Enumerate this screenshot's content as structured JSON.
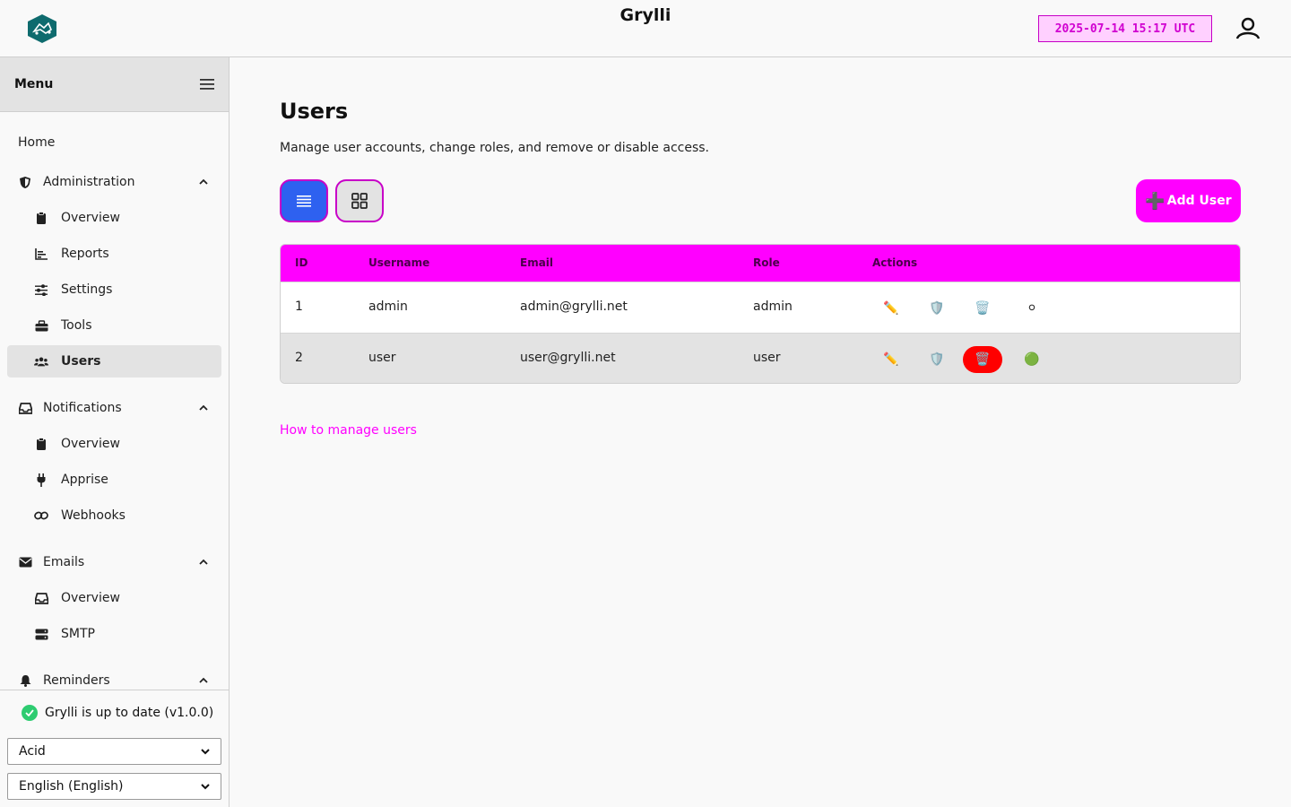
{
  "header": {
    "title": "Grylli",
    "datetime": "2025-07-14 15:17 UTC",
    "logo_icon": "grylli-logo-icon",
    "user_icon": "user-account-icon"
  },
  "sidebar": {
    "menu_title": "Menu",
    "home": "Home",
    "sections": [
      {
        "label": "Administration",
        "icon": "shield-icon",
        "items": [
          {
            "label": "Overview",
            "icon": "clipboard-icon"
          },
          {
            "label": "Reports",
            "icon": "chart-icon"
          },
          {
            "label": "Settings",
            "icon": "sliders-icon"
          },
          {
            "label": "Tools",
            "icon": "toolbox-icon"
          },
          {
            "label": "Users",
            "icon": "users-icon",
            "active": true
          }
        ]
      },
      {
        "label": "Notifications",
        "icon": "inbox-icon",
        "items": [
          {
            "label": "Overview",
            "icon": "clipboard-icon"
          },
          {
            "label": "Apprise",
            "icon": "plug-icon"
          },
          {
            "label": "Webhooks",
            "icon": "link-icon"
          }
        ]
      },
      {
        "label": "Emails",
        "icon": "envelope-icon",
        "items": [
          {
            "label": "Overview",
            "icon": "inbox-icon"
          },
          {
            "label": "SMTP",
            "icon": "server-icon"
          }
        ]
      },
      {
        "label": "Reminders",
        "icon": "bell-icon",
        "items": []
      }
    ],
    "footer": {
      "status": "Grylli is up to date (v1.0.0)",
      "theme": "Acid",
      "language": "English (English)"
    }
  },
  "main": {
    "title": "Users",
    "description": "Manage user accounts, change roles, and remove or disable access.",
    "add_button": "Add User",
    "add_button_icon": "➕",
    "table": {
      "columns": [
        "ID",
        "Username",
        "Email",
        "Role",
        "Actions"
      ],
      "rows": [
        {
          "id": "1",
          "username": "admin",
          "email": "admin@grylli.net",
          "role": "admin",
          "edit": "✏️",
          "role_action": "🛡️",
          "delete": "🗑️",
          "status_dot": "⚪"
        },
        {
          "id": "2",
          "username": "user",
          "email": "user@grylli.net",
          "role": "user",
          "edit": "✏️",
          "role_action": "🛡️",
          "delete": "🗑️",
          "status_dot": "🟢"
        }
      ]
    },
    "help_link": "How to manage users"
  },
  "colors": {
    "accent": "#ff00ff",
    "list_view": "#2e61f0",
    "delete": "#ff0000",
    "enabled": "#2ecc71"
  }
}
